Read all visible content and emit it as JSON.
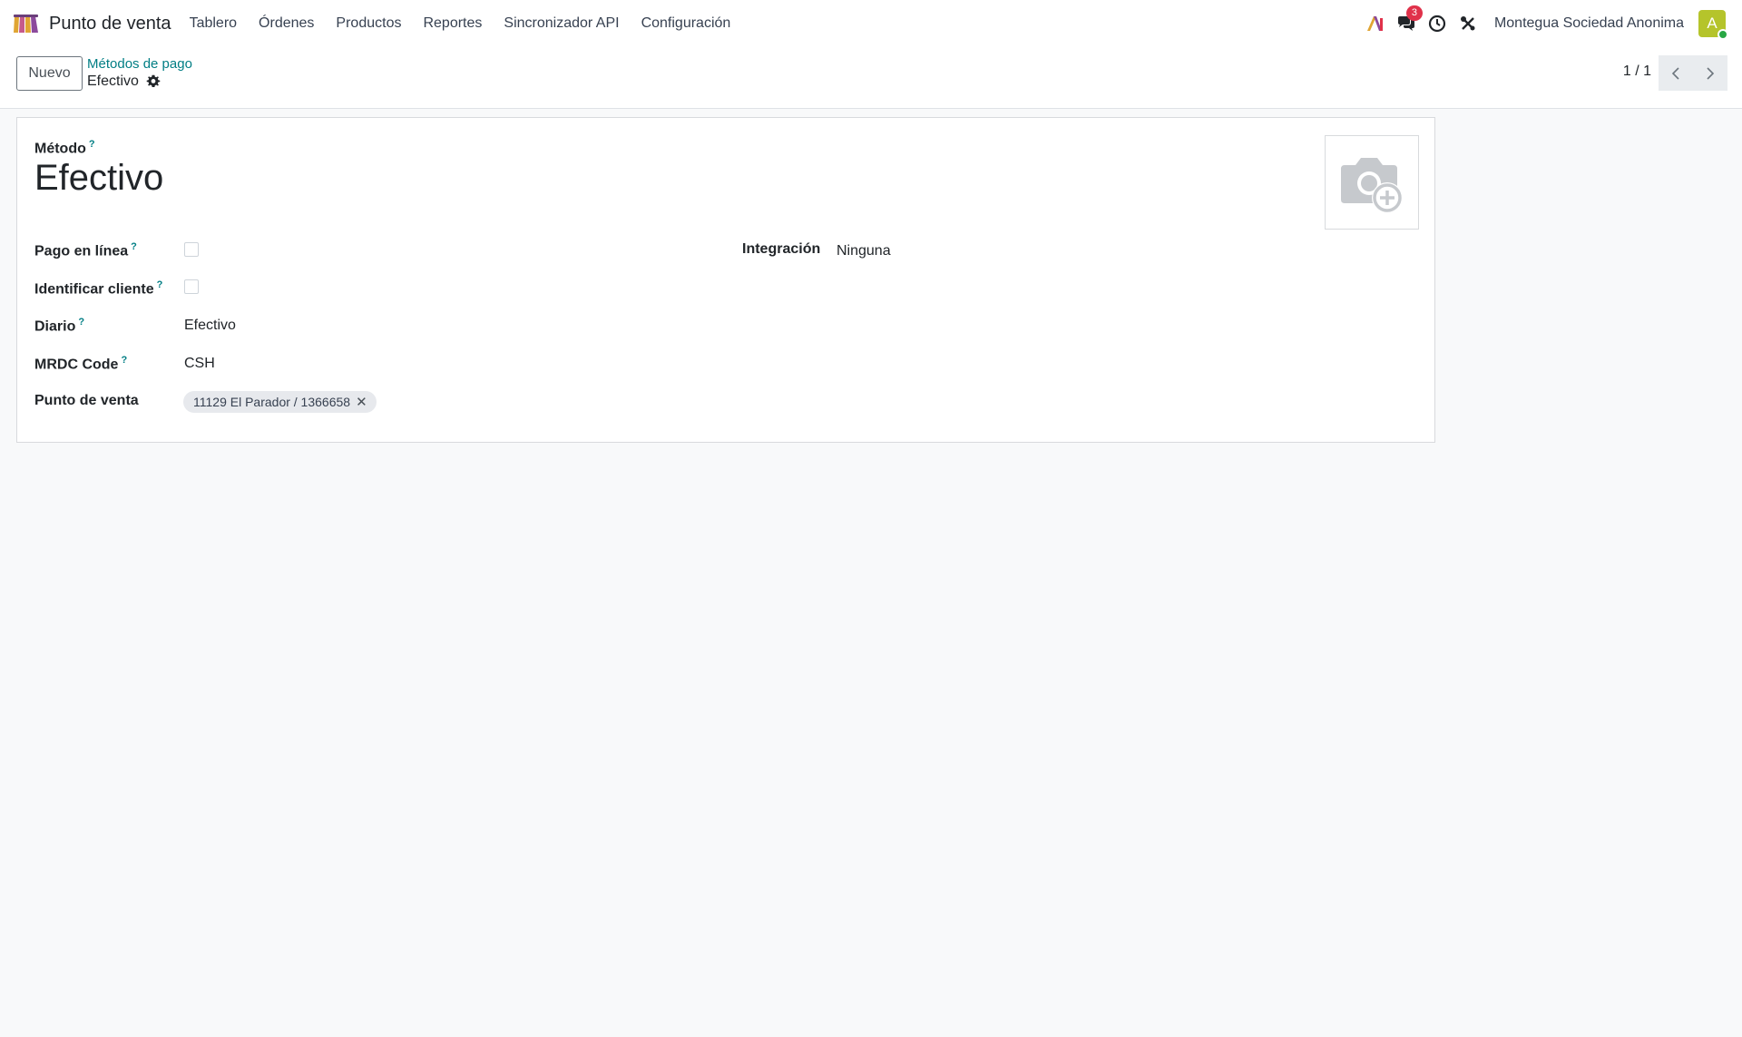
{
  "navbar": {
    "app_name": "Punto de venta",
    "menu": [
      "Tablero",
      "Órdenes",
      "Productos",
      "Reportes",
      "Sincronizador API",
      "Configuración"
    ],
    "messages_badge": "3",
    "company": "Montegua Sociedad Anonima",
    "avatar_letter": "A"
  },
  "control_panel": {
    "new_label": "Nuevo",
    "breadcrumb_parent": "Métodos de pago",
    "breadcrumb_current": "Efectivo",
    "pager": "1 / 1"
  },
  "form": {
    "method_label": "Método",
    "method_name": "Efectivo",
    "help_mark": "?",
    "online_payment_label": "Pago en línea",
    "online_payment_checked": false,
    "identify_customer_label": "Identificar cliente",
    "identify_customer_checked": false,
    "journal_label": "Diario",
    "journal_value": "Efectivo",
    "mrdc_label": "MRDC Code",
    "mrdc_value": "CSH",
    "pos_label": "Punto de venta",
    "pos_tag": "11129 El Parador / 1366658",
    "integration_label": "Integración",
    "integration_value": "Ninguna"
  },
  "icons": {
    "app_logo": "store-icon",
    "gear": "gear-icon",
    "image_placeholder": "camera-plus-icon"
  },
  "colors": {
    "accent": "#017e84",
    "badge": "#e0314a",
    "avatar": "#b5c42b"
  }
}
